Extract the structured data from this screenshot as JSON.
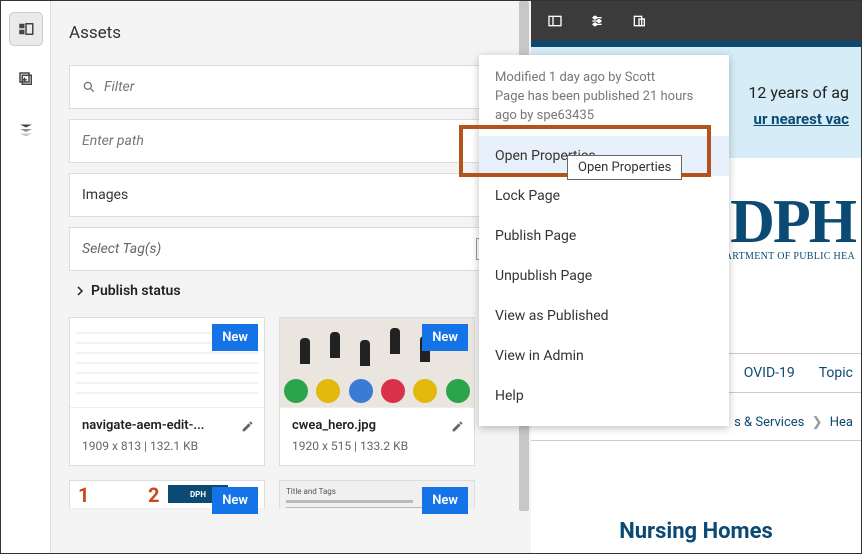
{
  "assets": {
    "title": "Assets",
    "filter_placeholder": "Filter",
    "path_placeholder": "Enter path",
    "type_value": "Images",
    "tags_placeholder": "Select Tag(s)",
    "publish_status": "Publish status",
    "badge_new": "New",
    "cards": [
      {
        "name": "navigate-aem-edit-...",
        "dims": "1909 x 813 | 132.1 KB"
      },
      {
        "name": "cwea_hero.jpg",
        "dims": "1920 x 515 | 133.2 KB"
      }
    ]
  },
  "popover": {
    "modified": "Modified 1 day ago by Scott",
    "published": "Page has been published 21 hours ago by spe63435",
    "items": {
      "open_properties": "Open Properties",
      "lock_page": "Lock Page",
      "publish_page": "Publish Page",
      "unpublish_page": "Unpublish Page",
      "view_as_published": "View as Published",
      "view_in_admin": "View in Admin",
      "help": "Help"
    },
    "tooltip": "Open Properties"
  },
  "preview": {
    "banner_text_1": "12 years of ag",
    "banner_link": "ur nearest vac",
    "dph_logo": "DPH",
    "dph_sub": "DEPARTMENT OF PUBLIC HEA",
    "tab_covid": "OVID-19",
    "tab_topics": "Topic",
    "crumb_services": "s & Services",
    "crumb_hea": "Hea",
    "nursing": "Nursing Homes"
  }
}
